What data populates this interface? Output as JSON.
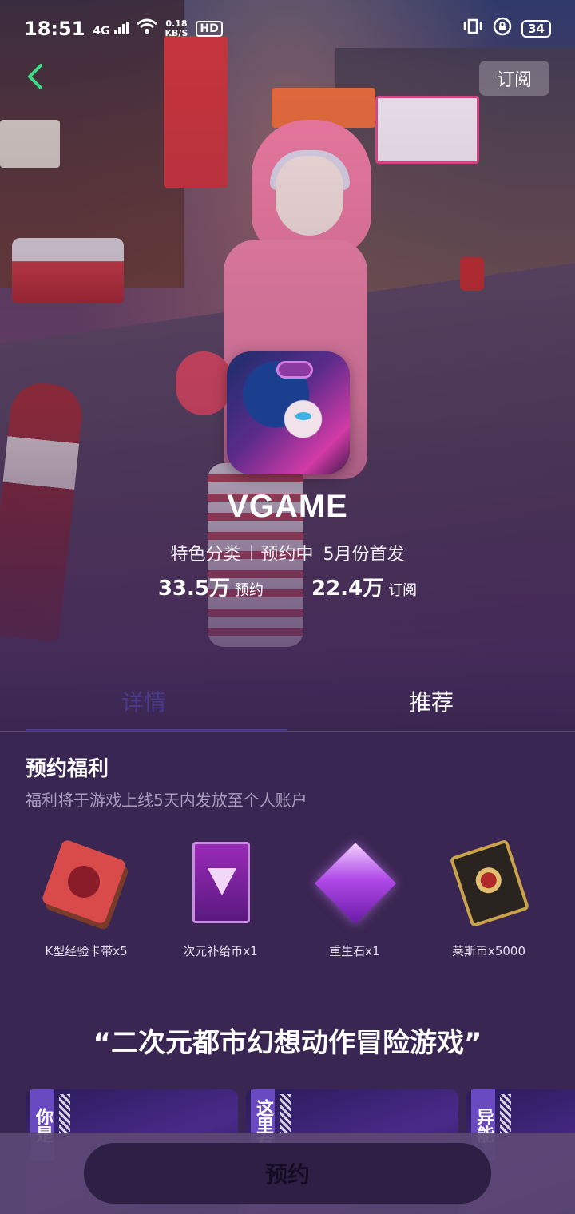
{
  "status_bar": {
    "time": "18:51",
    "network": "4G",
    "speed_value": "0.18",
    "speed_unit": "KB/S",
    "hd": "HD",
    "battery": "34"
  },
  "header": {
    "subscribe_label": "订阅"
  },
  "game": {
    "title": "VGAME",
    "category": "特色分类",
    "status": "预约中",
    "release": "5月份首发",
    "reservations_value": "33.5万",
    "reservations_label": "预约",
    "subscriptions_value": "22.4万",
    "subscriptions_label": "订阅"
  },
  "tabs": [
    {
      "label": "详情",
      "active": true
    },
    {
      "label": "推荐",
      "active": false
    }
  ],
  "benefits": {
    "title": "预约福利",
    "subtitle": "福利将于游戏上线5天内发放至个人账户",
    "items": [
      {
        "label": "K型经验卡带x5",
        "icon": "exp-cartridge-icon"
      },
      {
        "label": "次元补给币x1",
        "icon": "supply-coin-card-icon"
      },
      {
        "label": "重生石x1",
        "icon": "rebirth-gem-icon"
      },
      {
        "label": "莱斯币x5000",
        "icon": "rice-coin-card-icon"
      }
    ]
  },
  "slogan": "“二次元都市幻想动作冒险游戏”",
  "screenshots": [
    {
      "tag": "你是"
    },
    {
      "tag": "这里有"
    },
    {
      "tag": "异能"
    }
  ],
  "bottom": {
    "reserve_label": "预约"
  },
  "colors": {
    "background": "#3a2652",
    "accent_tab": "#4a3a8a",
    "back_arrow": "#3ddc84",
    "reserve_button": "#2e1f45"
  }
}
